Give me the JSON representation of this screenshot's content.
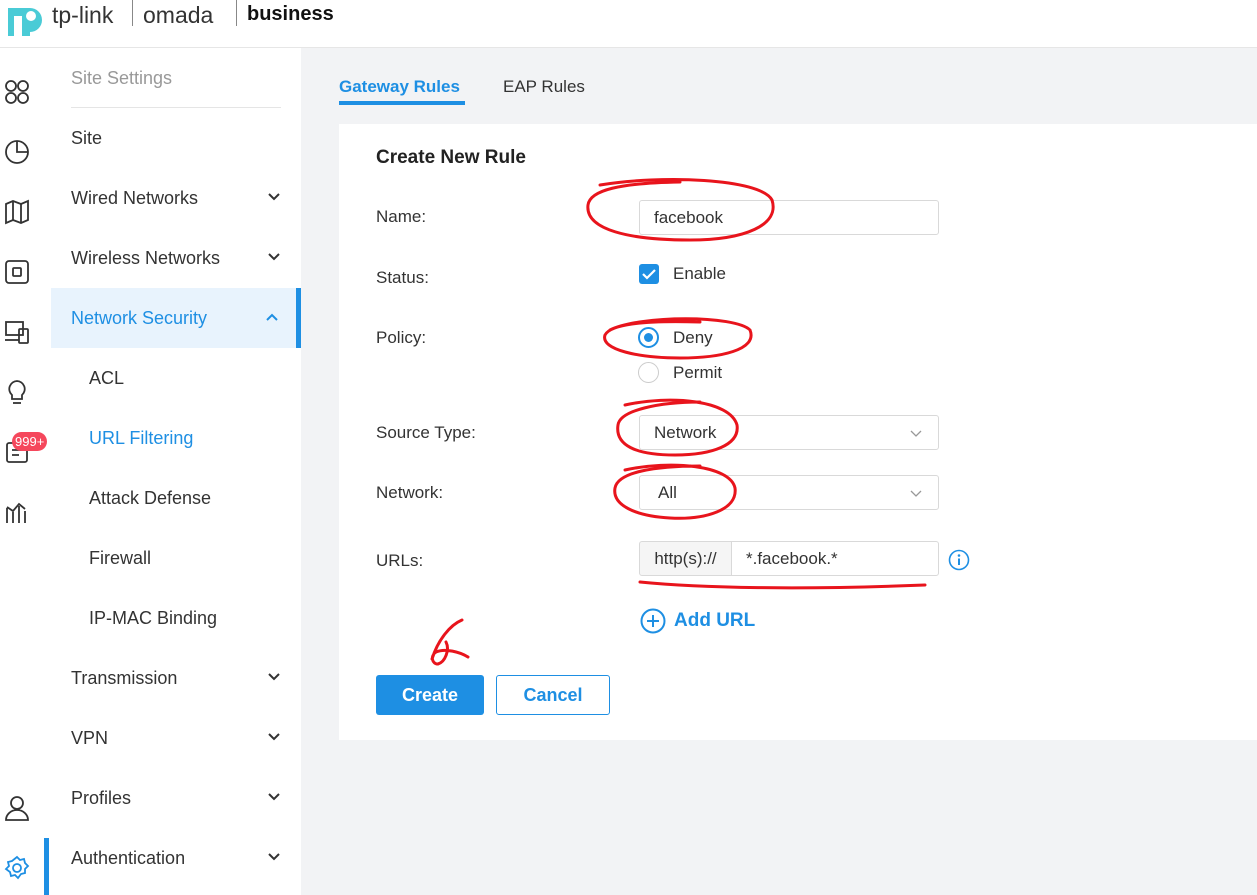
{
  "brand": {
    "tplink": "tp-link",
    "omada": "omada",
    "business": "business"
  },
  "rail": {
    "icons": [
      "dashboard-icon",
      "statistics-icon",
      "map-icon",
      "devices-icon",
      "clients-icon",
      "insight-icon",
      "logs-icon",
      "reports-icon",
      "account-icon",
      "settings-icon"
    ],
    "badge": "999+"
  },
  "sidebar": {
    "header": "Site Settings",
    "items": [
      {
        "label": "Site"
      },
      {
        "label": "Wired Networks"
      },
      {
        "label": "Wireless Networks"
      },
      {
        "label": "Network Security"
      },
      {
        "label": "ACL"
      },
      {
        "label": "URL Filtering"
      },
      {
        "label": "Attack Defense"
      },
      {
        "label": "Firewall"
      },
      {
        "label": "IP-MAC Binding"
      },
      {
        "label": "Transmission"
      },
      {
        "label": "VPN"
      },
      {
        "label": "Profiles"
      },
      {
        "label": "Authentication"
      }
    ]
  },
  "tabs": [
    {
      "label": "Gateway Rules"
    },
    {
      "label": "EAP Rules"
    }
  ],
  "form": {
    "title": "Create New Rule",
    "name_label": "Name",
    "name_value": "facebook",
    "status_label": "Status",
    "status_option": "Enable",
    "policy_label": "Policy",
    "policy_options": [
      "Deny",
      "Permit"
    ],
    "source_type_label": "Source Type",
    "source_type_value": "Network",
    "network_label": "Network",
    "network_value": "All",
    "urls_label": "URLs",
    "url_prefix": "http(s)://",
    "url_value": "*.facebook.*",
    "add_url": "Add URL",
    "create": "Create",
    "cancel": "Cancel"
  },
  "colors": {
    "accent": "#1e8fe3",
    "badge": "#f5475c",
    "annotation": "#e8141c"
  },
  "annotation": {
    "step": "6"
  }
}
